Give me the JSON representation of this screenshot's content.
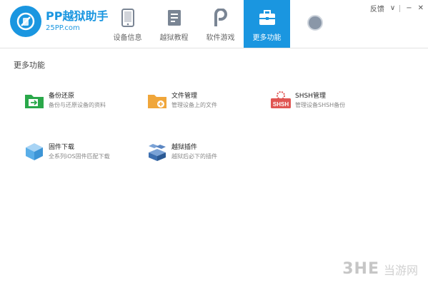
{
  "app": {
    "title": "PP越狱助手",
    "subtitle": "25PP.com"
  },
  "tabs": [
    {
      "label": "设备信息",
      "icon": "phone-icon",
      "active": false
    },
    {
      "label": "越狱教程",
      "icon": "book-icon",
      "active": false
    },
    {
      "label": "软件游戏",
      "icon": "pp-app-icon",
      "active": false
    },
    {
      "label": "更多功能",
      "icon": "toolbox-icon",
      "active": true
    }
  ],
  "window": {
    "feedback": "反馈",
    "menu": "∨",
    "minimize": "−",
    "close": "✕"
  },
  "section": {
    "title": "更多功能"
  },
  "features": [
    {
      "name": "备份还原",
      "desc": "备份与还原设备的资料",
      "icon": "folder-backup-icon",
      "color": "#2aa84a"
    },
    {
      "name": "文件管理",
      "desc": "管理设备上的文件",
      "icon": "folder-file-icon",
      "color": "#f0a63a"
    },
    {
      "name": "SHSH管理",
      "desc": "管理设备SHSH备份",
      "icon": "shsh-icon",
      "color": "#e05552"
    },
    {
      "name": "固件下载",
      "desc": "全系列iOS固件匹配下载",
      "icon": "firmware-cube-icon",
      "color": "#5aaee8"
    },
    {
      "name": "越狱插件",
      "desc": "越狱后必下的插件",
      "icon": "plugin-box-icon",
      "color": "#3d6fb0"
    }
  ],
  "watermark": {
    "text": "3HE",
    "cn": "当游网"
  },
  "colors": {
    "accent": "#1a96e0"
  }
}
